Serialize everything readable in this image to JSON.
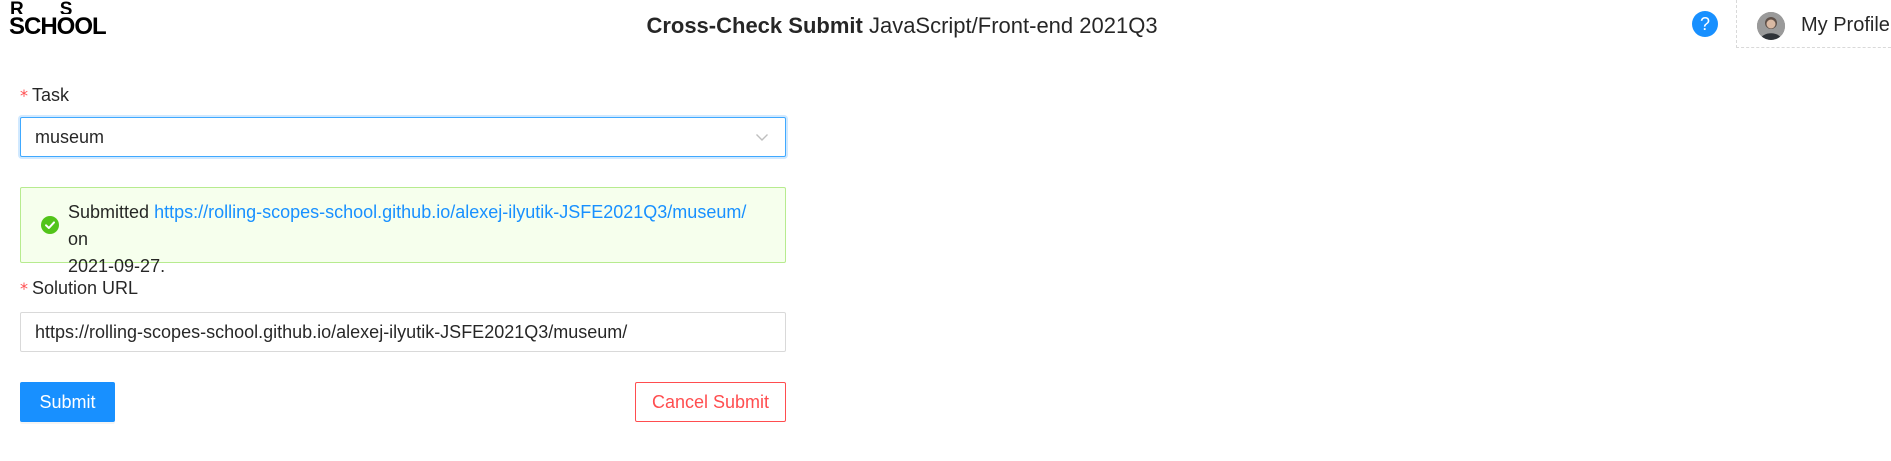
{
  "header": {
    "logo": {
      "row1_left": "R",
      "row1_right": "S",
      "row2": "SCHOOL"
    },
    "title_bold": "Cross-Check Submit",
    "title_rest": "JavaScript/Front-end 2021Q3",
    "help_label": "?",
    "help_icon": "question-circle-icon",
    "profile_label": "My Profile"
  },
  "form": {
    "task": {
      "required_mark": "*",
      "label": "Task",
      "selected_value": "museum"
    },
    "status": {
      "icon": "check-circle-icon",
      "prefix": "Submitted",
      "link": "https://rolling-scopes-school.github.io/alexej-ilyutik-JSFE2021Q3/museum/",
      "middle": "on",
      "date": "2021-09-27."
    },
    "solution_url": {
      "required_mark": "*",
      "label": "Solution URL",
      "value": "https://rolling-scopes-school.github.io/alexej-ilyutik-JSFE2021Q3/museum/"
    },
    "submit_label": "Submit",
    "cancel_label": "Cancel Submit"
  },
  "colors": {
    "primary": "#1890ff",
    "danger": "#ff4d4f",
    "success": "#52c41a",
    "success_bg": "#f6ffed",
    "success_border": "#b7eb8f"
  }
}
